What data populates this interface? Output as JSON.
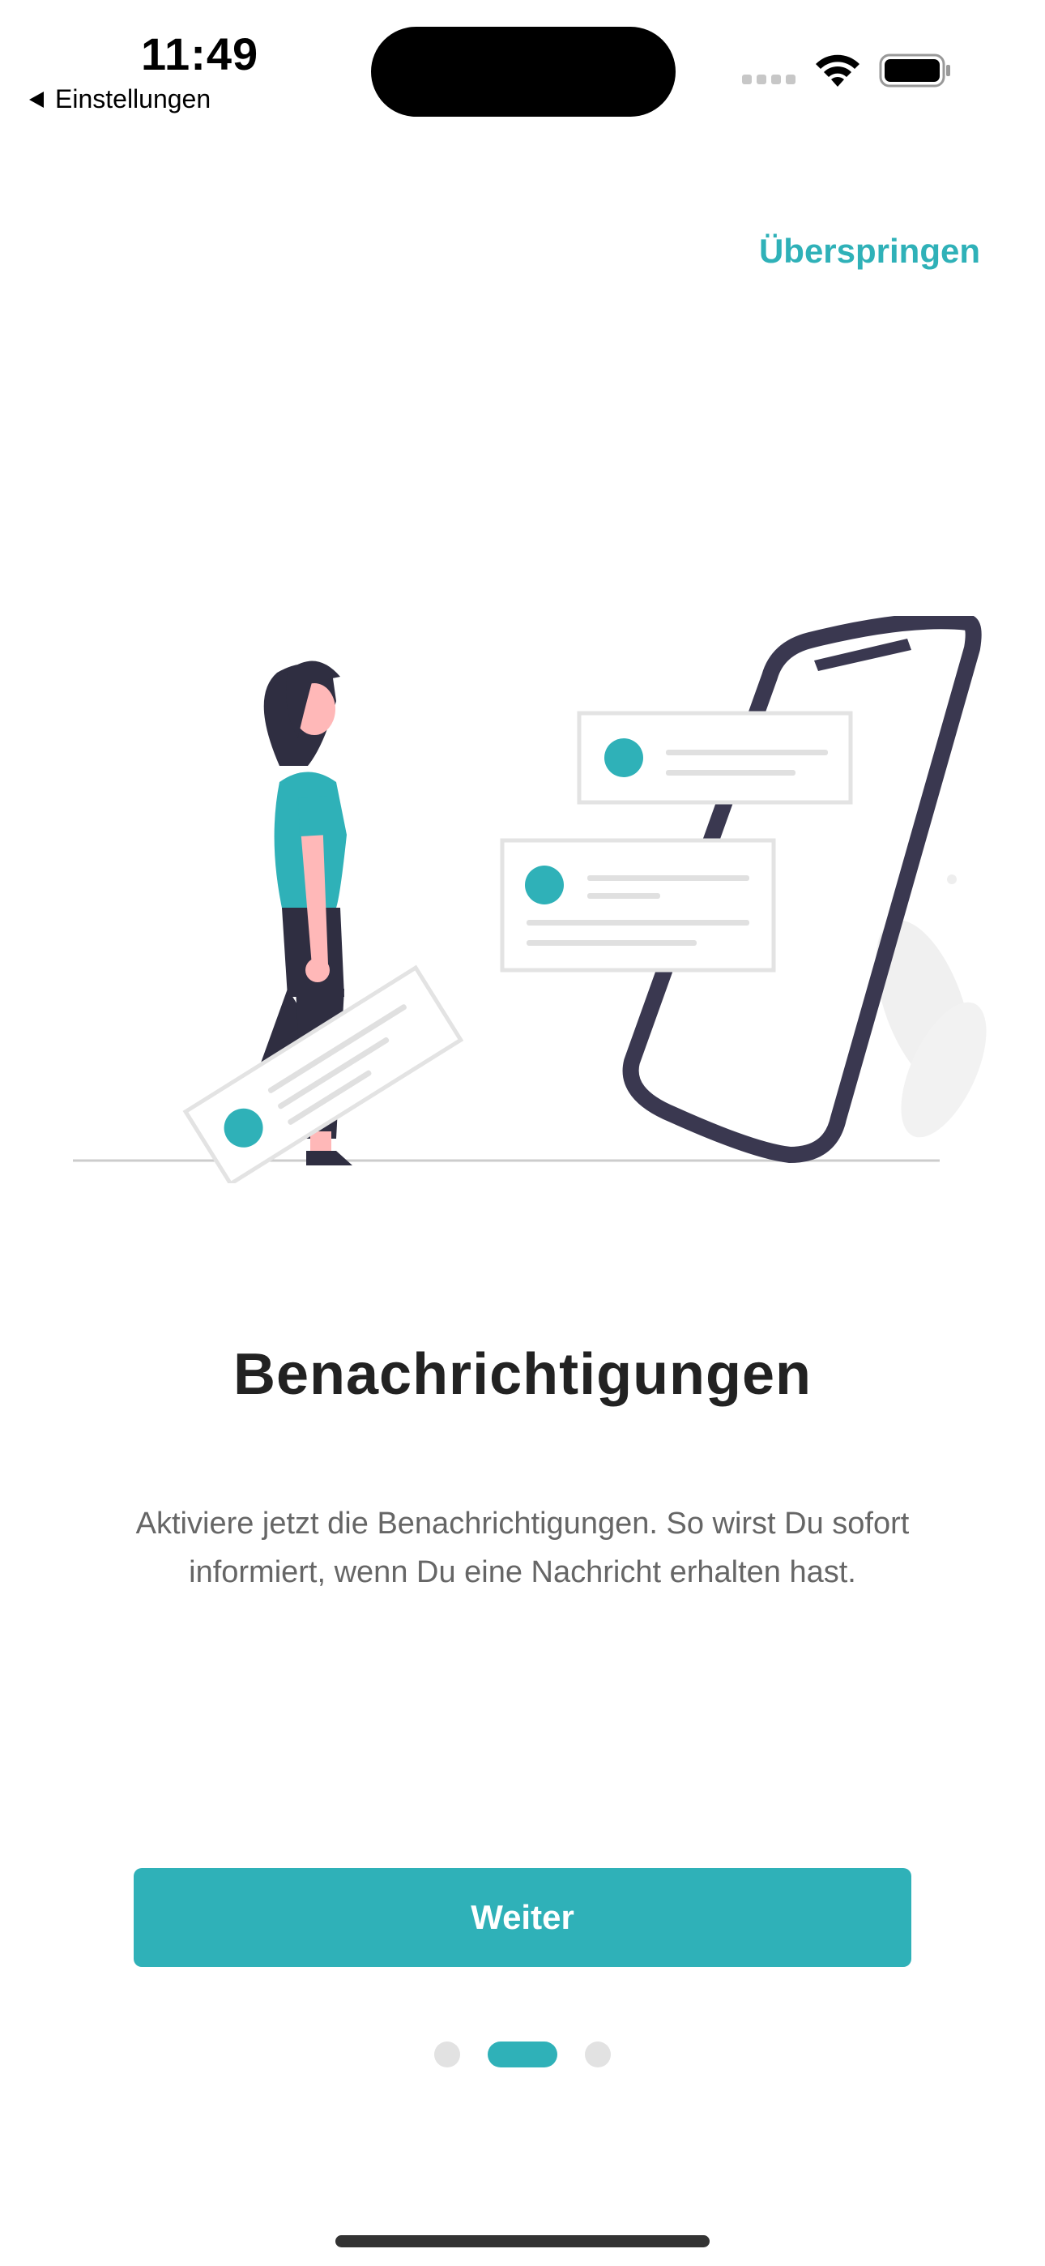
{
  "status_bar": {
    "time": "11:49",
    "back_label": "Einstellungen"
  },
  "header": {
    "skip_label": "Überspringen"
  },
  "illustration": {
    "icon": "notification-illustration",
    "accent_color": "#2fb1b8"
  },
  "onboarding": {
    "title": "Benachrichtigungen",
    "description": "Aktiviere jetzt die Benachrichtigungen. So wirst Du sofort informiert, wenn Du eine Nachricht erhalten hast."
  },
  "actions": {
    "next_label": "Weiter"
  },
  "pager": {
    "total": 3,
    "current": 2
  },
  "colors": {
    "accent": "#2fb1b8",
    "title": "#222222",
    "text": "#666666"
  }
}
